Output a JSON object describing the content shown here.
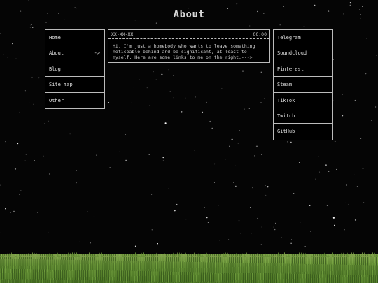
{
  "page": {
    "title": "About",
    "background_color": "#050505",
    "accent_color": "#bbbbbb"
  },
  "nav": {
    "items": [
      {
        "label": "Home",
        "marker": ""
      },
      {
        "label": "About",
        "marker": "->"
      },
      {
        "label": "Blog",
        "marker": ""
      },
      {
        "label": "Site_map",
        "marker": ""
      },
      {
        "label": "Other",
        "marker": ""
      }
    ]
  },
  "post": {
    "date": "XX-XX-XX",
    "time": "00:00",
    "body": "Hi, I'm just a homebody who wants to leave something noticeable behind and be significant, at least to myself. Here are some links to me on the right.--->"
  },
  "links": {
    "items": [
      {
        "label": "Telegram"
      },
      {
        "label": "Soundcloud"
      },
      {
        "label": "Pinterest"
      },
      {
        "label": "Steam"
      },
      {
        "label": "TikTok"
      },
      {
        "label": "Twitch"
      },
      {
        "label": "GitHub"
      }
    ]
  },
  "footer": {
    "grass_color": "#5f8a31"
  }
}
